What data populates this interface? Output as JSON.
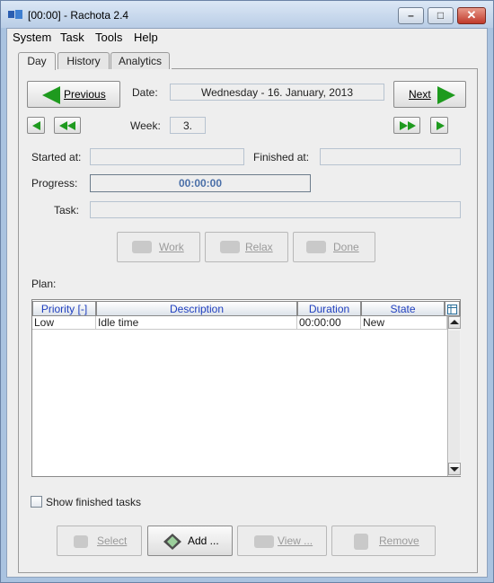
{
  "window": {
    "title": "[00:00] - Rachota 2.4"
  },
  "menu": [
    {
      "label": "System"
    },
    {
      "label": "Task"
    },
    {
      "label": "Tools"
    },
    {
      "label": "Help"
    }
  ],
  "tabs": [
    {
      "label": "Day"
    },
    {
      "label": "History"
    },
    {
      "label": "Analytics"
    }
  ],
  "nav": {
    "previous_label": "Previous",
    "next_label": "Next",
    "date_label": "Date:",
    "date_value": "Wednesday - 16. January, 2013",
    "week_label": "Week:",
    "week_value": "3."
  },
  "task_info": {
    "started_label": "Started at:",
    "started_value": "",
    "finished_label": "Finished at:",
    "finished_value": "",
    "progress_label": "Progress:",
    "progress_value": "00:00:00",
    "task_label": "Task:",
    "task_value": ""
  },
  "actions": {
    "work_label": "Work",
    "relax_label": "Relax",
    "done_label": "Done"
  },
  "plan": {
    "label": "Plan:",
    "columns": [
      "Priority [-]",
      "Description",
      "Duration",
      "State"
    ],
    "rows": [
      {
        "priority": "Low",
        "description": "Idle time",
        "duration": "00:00:00",
        "state": "New"
      }
    ]
  },
  "show_finished_label": "Show finished tasks",
  "bottom_buttons": {
    "select_label": "Select",
    "add_label": "Add ...",
    "view_label": "View ...",
    "remove_label": "Remove"
  },
  "colors": {
    "accent_green": "#1e9a1e",
    "header_text": "#1f3fbf"
  }
}
